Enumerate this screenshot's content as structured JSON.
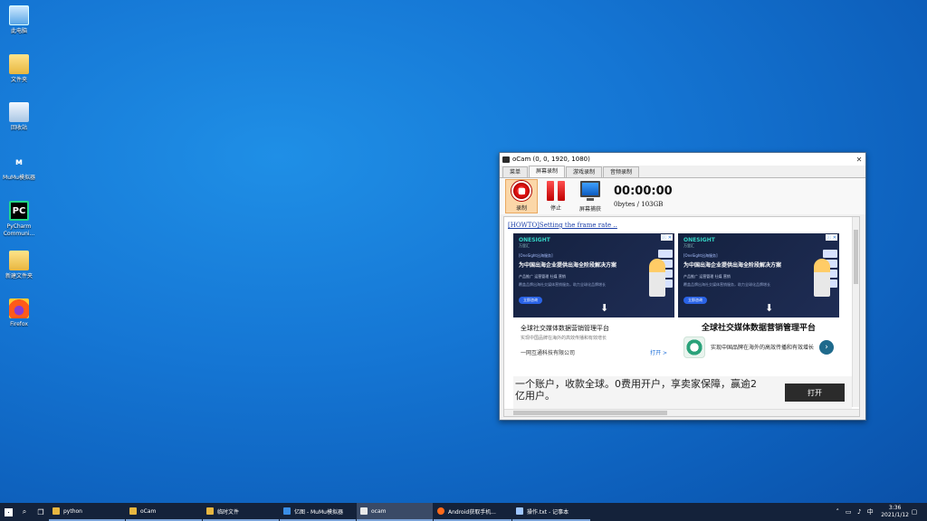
{
  "desktop": {
    "icons": [
      {
        "label": "此电脑",
        "icon": "computer-icon"
      },
      {
        "label": "文件夹",
        "icon": "folder-icon"
      },
      {
        "label": "回收站",
        "icon": "recycle-bin-icon"
      },
      {
        "label": "MuMu模拟器",
        "icon": "mumu-icon"
      },
      {
        "label": "PyCharm Communi...",
        "icon": "pycharm-icon"
      },
      {
        "label": "新建文件夹",
        "icon": "folder-icon"
      },
      {
        "label": "Firefox",
        "icon": "firefox-icon"
      }
    ]
  },
  "ocam": {
    "title": "oCam (0, 0, 1920, 1080)",
    "tabs": [
      "菜单",
      "屏幕录制",
      "游戏录制",
      "音频录制"
    ],
    "active_tab": 1,
    "tools": [
      {
        "label": "录制",
        "icon": "record-icon"
      },
      {
        "label": "停止",
        "icon": "pause-icon"
      },
      {
        "label": "屏幕捕获",
        "icon": "screen-capture-icon"
      }
    ],
    "timer": "00:00:00",
    "size": "0bytes / 103GB",
    "howto_link": "[HOWTO]Setting the frame rate ..",
    "ads": {
      "card1": {
        "brand": "ONESIGHT",
        "brand_sub": "万里汇",
        "tag": "[OneSight出海服务]",
        "headline": "为中国出海企业提供出海全阶段解决方案",
        "line": "产品推广 运营管理 社媒 营销",
        "line2": "覆盖品牌出海社交媒体营销服务，助力全球化品牌增长",
        "cta": "立即咨询",
        "title": "全球社交媒体数据营销管理平台",
        "desc": "实现中国品牌在海外的高效传播和有效增长",
        "company": "一网互通科技有限公司",
        "open": "打开 >"
      },
      "card2": {
        "brand": "ONESIGHT",
        "brand_sub": "万里汇",
        "tag": "[OneSight出海服务]",
        "headline": "为中国出海企业提供出海全阶段解决方案",
        "line": "产品推广 运营管理 社媒 营销",
        "line2": "覆盖品牌出海社交媒体营销服务，助力全球化品牌增长",
        "cta": "立即咨询",
        "title": "全球社交媒体数据营销管理平台",
        "desc": "实现中国品牌在海外的高效传播和有效增长"
      },
      "adchoice": "ⓘ ✕",
      "bottom_text": "一个账户，收款全球。0费用开户，享卖家保障，赢逾2亿用户。",
      "bottom_btn": "打开"
    }
  },
  "taskbar": {
    "items": [
      {
        "label": "python",
        "color": "#e7b640"
      },
      {
        "label": "oCam",
        "color": "#e7b640"
      },
      {
        "label": "临时文件",
        "color": "#e7b640"
      },
      {
        "label": "亿图 - MuMu模拟器",
        "color": "#3a8ee6"
      },
      {
        "label": "ocam",
        "color": "#e9e9e9"
      },
      {
        "label": "Android获取手机...",
        "color": "#ff6a1a"
      },
      {
        "label": "操作.txt - 记事本",
        "color": "#9ec6ff"
      }
    ],
    "active_index": 4,
    "time": "3:36",
    "date": "2021/1/12"
  }
}
